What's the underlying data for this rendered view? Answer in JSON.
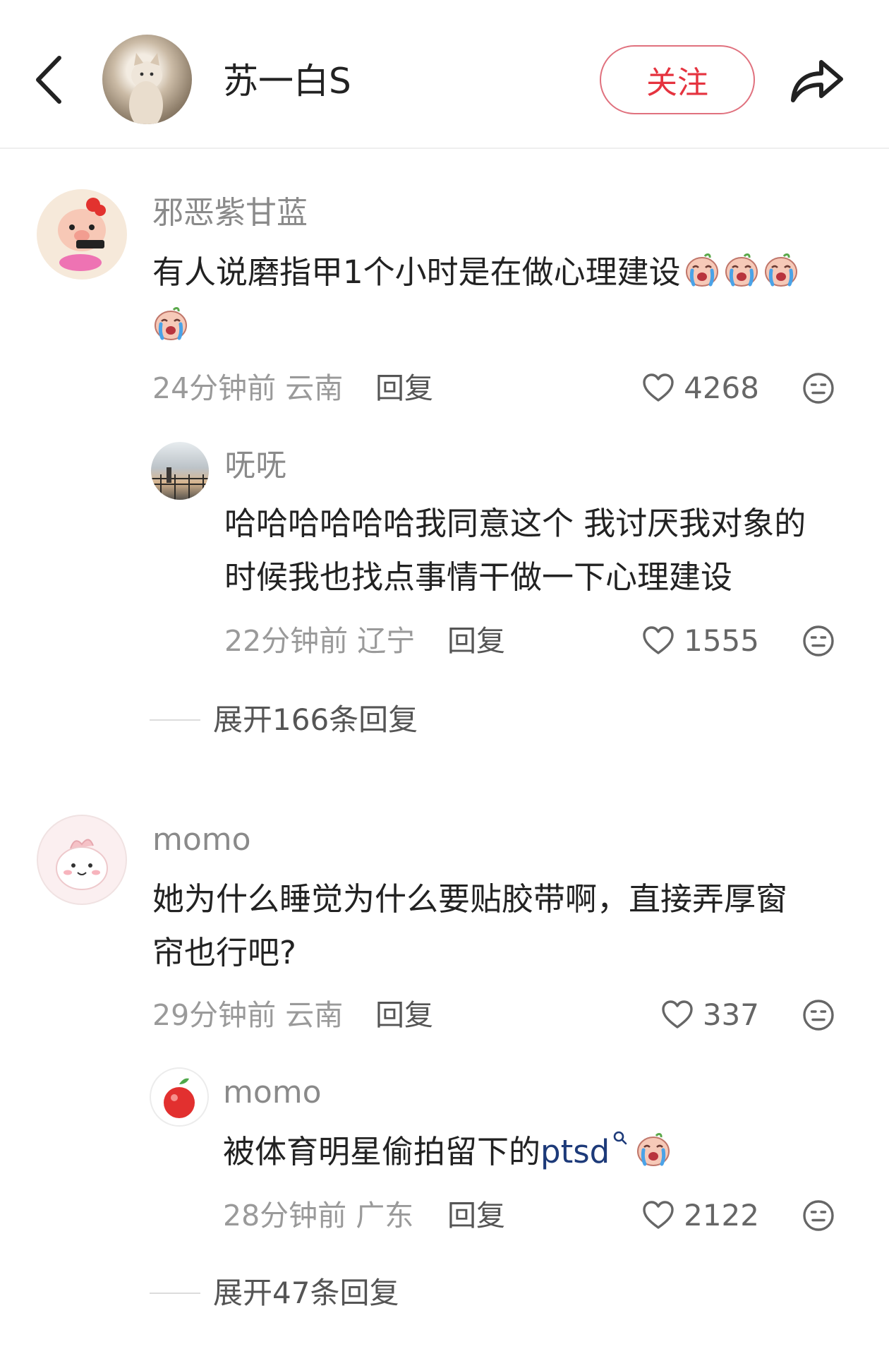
{
  "header": {
    "username": "苏一白S",
    "follow_label": "关注"
  },
  "comments": [
    {
      "username": "邪恶紫甘蓝",
      "text": "有人说磨指甲1个小时是在做心理建设",
      "emoji_count": 4,
      "time": "24分钟前",
      "location": "云南",
      "reply_label": "回复",
      "likes": "4268",
      "replies": [
        {
          "username": "呒呒",
          "text_line1": "哈哈哈哈哈哈我同意这个 我讨厌我对象的",
          "text_line2": "时候我也找点事情干做一下心理建设",
          "time": "22分钟前",
          "location": "辽宁",
          "reply_label": "回复",
          "likes": "1555"
        }
      ],
      "expand_label": "展开166条回复"
    },
    {
      "username": "momo",
      "text_line1": "她为什么睡觉为什么要贴胶带啊，直接弄厚窗",
      "text_line2": "帘也行吧?",
      "time": "29分钟前",
      "location": "云南",
      "reply_label": "回复",
      "likes": "337",
      "replies": [
        {
          "username": "momo",
          "text": "被体育明星偷拍留下的",
          "link_text": "ptsd",
          "time": "28分钟前",
          "location": "广东",
          "reply_label": "回复",
          "likes": "2122"
        }
      ],
      "expand_label": "展开47条回复"
    }
  ],
  "icons": {
    "back": "chevron-left-icon",
    "share": "share-arrow-icon",
    "like": "heart-outline-icon",
    "more": "meh-face-icon",
    "search_link": "search-icon"
  },
  "colors": {
    "accent_red": "#e5333f",
    "link_blue": "#1d3a79",
    "meta_gray": "#9a9a9a"
  }
}
